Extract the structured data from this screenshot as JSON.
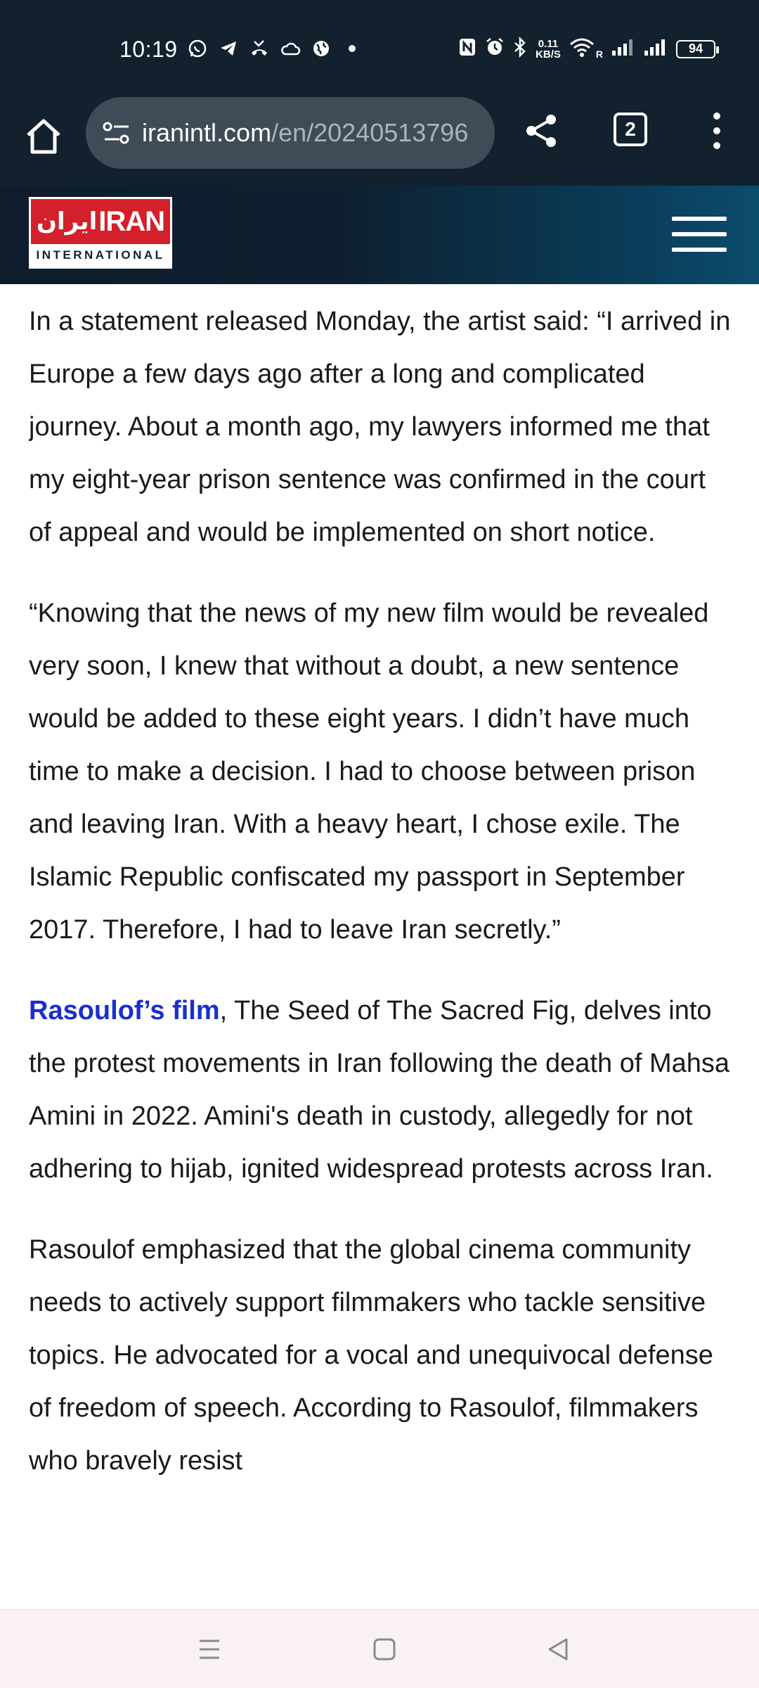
{
  "status_bar": {
    "time": "10:19",
    "net_speed_value": "0.11",
    "net_speed_unit": "KB/S",
    "roaming_label": "R",
    "battery": "94",
    "left_icons": [
      "whatsapp-icon",
      "telegram-icon",
      "missed-call-icon",
      "cloud-icon",
      "globe-icon",
      "dot-icon"
    ],
    "right_icons": [
      "nfc-icon",
      "alarm-icon",
      "bluetooth-icon",
      "wifi-icon",
      "signal-icon",
      "signal-icon",
      "battery-icon"
    ]
  },
  "browser": {
    "url_host": "iranintl.com",
    "url_path": "/en/20240513796",
    "tab_count": "2"
  },
  "site": {
    "logo_farsi": "ایران",
    "logo_english": "IRAN",
    "logo_sub": "INTERNATIONAL"
  },
  "article": {
    "p1": "In a statement released Monday, the artist said: “I arrived in Europe a few days ago after a long and complicated journey. About a month ago, my lawyers informed me that my eight-year prison sentence was confirmed in the court of appeal and would be implemented on short notice.",
    "p2": "“Knowing that the news of my new film would be revealed very soon, I knew that without a doubt, a new sentence would be added to these eight years. I didn’t have much time to make a decision. I had to choose between prison and leaving Iran. With a heavy heart, I chose exile. The Islamic Republic confiscated my passport in September 2017. Therefore, I had to leave Iran secretly.”",
    "p3_link": "Rasoulof’s film",
    "p3_rest": ", The Seed of The Sacred Fig, delves into the protest movements in Iran following the death of Mahsa Amini in 2022. Amini's death in custody, allegedly for not adhering to hijab, ignited widespread protests across Iran.",
    "p4": "Rasoulof emphasized that the global cinema community needs to actively support filmmakers who tackle sensitive topics. He advocated for a vocal and unequivocal defense of freedom of speech. According to Rasoulof, filmmakers who bravely resist"
  },
  "colors": {
    "top_bar": "#13202e",
    "url_pill": "#3f4b57",
    "logo_red": "#d3202b",
    "link": "#1a2fcc",
    "nav_bar": "#faf2f2"
  }
}
